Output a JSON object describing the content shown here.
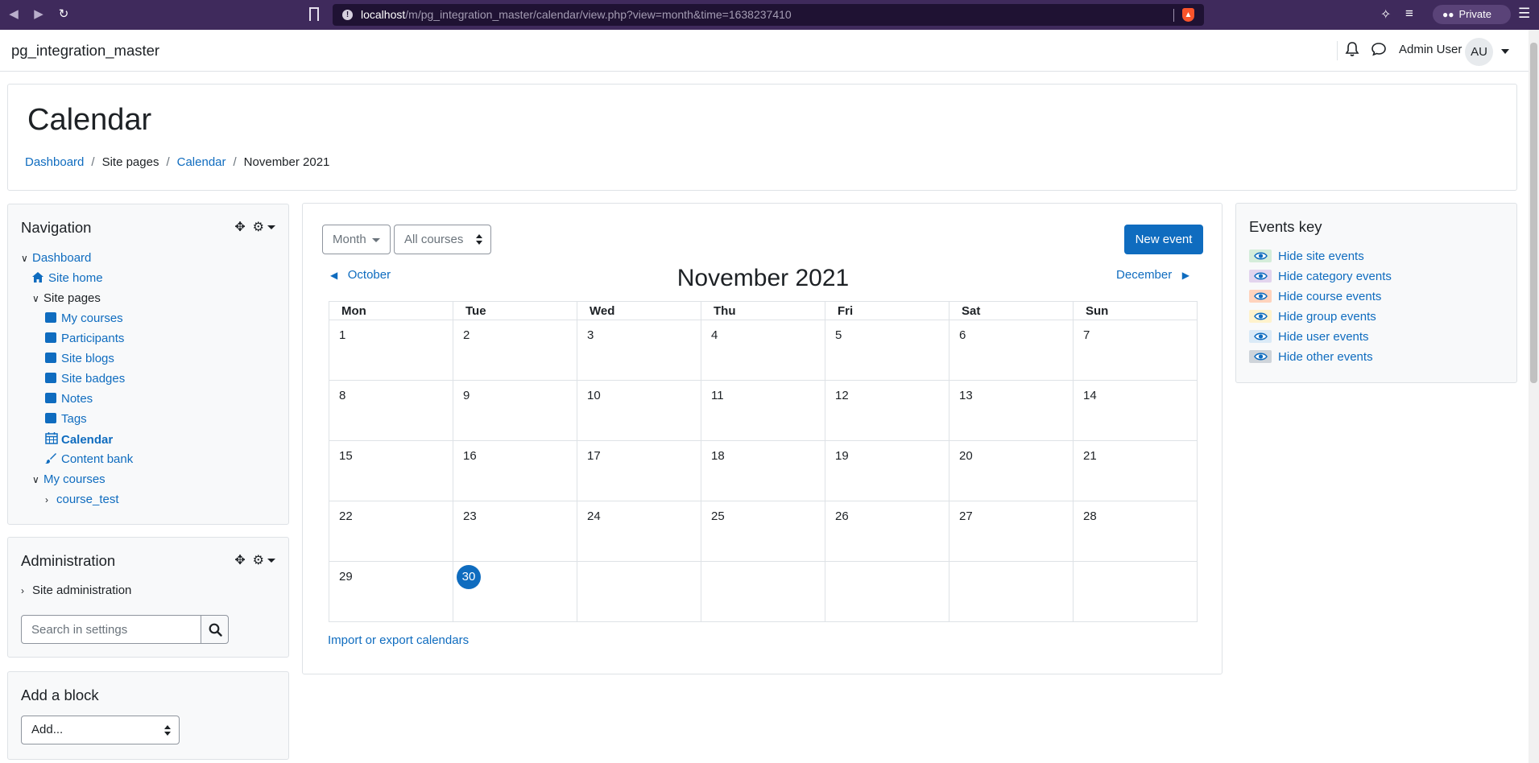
{
  "browser": {
    "url_host": "localhost",
    "url_path": "/m/pg_integration_master/calendar/view.php?view=month&time=1638237410",
    "private_label": "Private"
  },
  "site": {
    "name": "pg_integration_master",
    "user_name": "Admin User",
    "user_initials": "AU"
  },
  "header": {
    "title": "Calendar",
    "breadcrumb": [
      {
        "label": "Dashboard",
        "link": true
      },
      {
        "label": "Site pages",
        "link": false
      },
      {
        "label": "Calendar",
        "link": true
      },
      {
        "label": "November 2021",
        "link": false
      }
    ]
  },
  "navigation": {
    "title": "Navigation",
    "items": [
      {
        "label": "Dashboard",
        "link": true,
        "toggle": "down",
        "icon": "none"
      },
      {
        "label": "Site home",
        "link": true,
        "toggle": "none",
        "icon": "home-icon"
      },
      {
        "label": "Site pages",
        "link": false,
        "toggle": "down",
        "icon": "none"
      },
      {
        "label": "My courses",
        "link": true,
        "toggle": "none",
        "icon": "square-icon"
      },
      {
        "label": "Participants",
        "link": true,
        "toggle": "none",
        "icon": "square-icon"
      },
      {
        "label": "Site blogs",
        "link": true,
        "toggle": "none",
        "icon": "square-icon"
      },
      {
        "label": "Site badges",
        "link": true,
        "toggle": "none",
        "icon": "square-icon"
      },
      {
        "label": "Notes",
        "link": true,
        "toggle": "none",
        "icon": "square-icon"
      },
      {
        "label": "Tags",
        "link": true,
        "toggle": "none",
        "icon": "square-icon"
      },
      {
        "label": "Calendar",
        "link": true,
        "toggle": "none",
        "icon": "calendar-icon",
        "bold": true
      },
      {
        "label": "Content bank",
        "link": true,
        "toggle": "none",
        "icon": "brush-icon"
      },
      {
        "label": "My courses",
        "link": true,
        "toggle": "down",
        "icon": "none"
      },
      {
        "label": "course_test",
        "link": true,
        "toggle": "right",
        "icon": "none"
      }
    ]
  },
  "administration": {
    "title": "Administration",
    "site_admin_label": "Site administration",
    "search_placeholder": "Search in settings"
  },
  "add_block": {
    "title": "Add a block",
    "select_value": "Add..."
  },
  "calendar": {
    "view_select": "Month",
    "course_select": "All courses",
    "new_event_label": "New event",
    "prev_month": "October",
    "next_month": "December",
    "month_title": "November 2021",
    "weekdays": [
      "Mon",
      "Tue",
      "Wed",
      "Thu",
      "Fri",
      "Sat",
      "Sun"
    ],
    "weeks": [
      [
        "1",
        "2",
        "3",
        "4",
        "5",
        "6",
        "7"
      ],
      [
        "8",
        "9",
        "10",
        "11",
        "12",
        "13",
        "14"
      ],
      [
        "15",
        "16",
        "17",
        "18",
        "19",
        "20",
        "21"
      ],
      [
        "22",
        "23",
        "24",
        "25",
        "26",
        "27",
        "28"
      ],
      [
        "29",
        "30",
        "",
        "",
        "",
        "",
        ""
      ]
    ],
    "today": "30",
    "import_export_label": "Import or export calendars"
  },
  "events_key": {
    "title": "Events key",
    "items": [
      {
        "label": "Hide site events",
        "color": "#d4edda"
      },
      {
        "label": "Hide category events",
        "color": "#e2d4ee"
      },
      {
        "label": "Hide course events",
        "color": "#ffd3bd"
      },
      {
        "label": "Hide group events",
        "color": "#fff2cc"
      },
      {
        "label": "Hide user events",
        "color": "#daeaf7"
      },
      {
        "label": "Hide other events",
        "color": "#ced4da"
      }
    ]
  },
  "colors": {
    "accent": "#0f6cbf",
    "browser_frame": "#3f2a5c"
  }
}
